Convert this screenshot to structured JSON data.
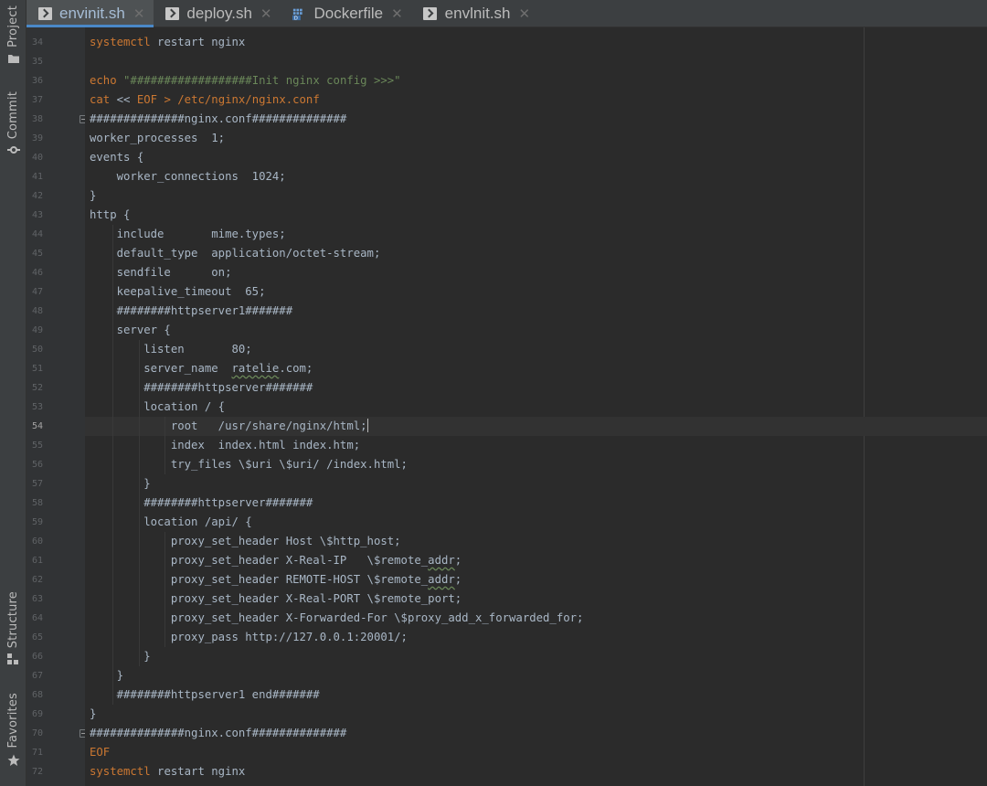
{
  "tool_window_bar": {
    "project_label": "Project",
    "commit_label": "Commit",
    "structure_label": "Structure",
    "favorites_label": "Favorites"
  },
  "tabs": [
    {
      "label": "envinit.sh",
      "icon": "shell-script-icon",
      "active": true
    },
    {
      "label": "deploy.sh",
      "icon": "shell-script-icon",
      "active": false
    },
    {
      "label": "Dockerfile",
      "icon": "docker-icon",
      "active": false
    },
    {
      "label": "envlnit.sh",
      "icon": "shell-script-icon",
      "active": false
    }
  ],
  "editor": {
    "current_line": 54,
    "line_numbers": [
      "34",
      "35",
      "36",
      "37",
      "38",
      "39",
      "40",
      "41",
      "42",
      "43",
      "44",
      "45",
      "46",
      "47",
      "48",
      "49",
      "50",
      "51",
      "52",
      "53",
      "54",
      "55",
      "56",
      "57",
      "58",
      "59",
      "60",
      "61",
      "62",
      "63",
      "64",
      "65",
      "66",
      "67",
      "68",
      "69",
      "70",
      "71",
      "72"
    ],
    "lines": [
      {
        "n": 34,
        "segs": [
          {
            "t": "systemctl",
            "c": "kw"
          },
          {
            "t": " restart nginx",
            "c": "plain"
          }
        ]
      },
      {
        "n": 35,
        "segs": []
      },
      {
        "n": 36,
        "segs": [
          {
            "t": "echo",
            "c": "kw"
          },
          {
            "t": " ",
            "c": "plain"
          },
          {
            "t": "\"##################Init nginx config >>>\"",
            "c": "str"
          }
        ]
      },
      {
        "n": 37,
        "segs": [
          {
            "t": "cat",
            "c": "kw"
          },
          {
            "t": " << ",
            "c": "plain"
          },
          {
            "t": "EOF",
            "c": "kw"
          },
          {
            "t": " > /etc/nginx/nginx.conf",
            "c": "kw"
          }
        ]
      },
      {
        "n": 38,
        "segs": [
          {
            "t": "##############nginx.conf##############",
            "c": "plain"
          }
        ]
      },
      {
        "n": 39,
        "segs": [
          {
            "t": "worker_processes  1;",
            "c": "plain"
          }
        ]
      },
      {
        "n": 40,
        "segs": [
          {
            "t": "events {",
            "c": "plain"
          }
        ]
      },
      {
        "n": 41,
        "segs": [
          {
            "t": "    worker_connections  1024;",
            "c": "plain"
          }
        ]
      },
      {
        "n": 42,
        "segs": [
          {
            "t": "}",
            "c": "plain"
          }
        ]
      },
      {
        "n": 43,
        "segs": [
          {
            "t": "http {",
            "c": "plain"
          }
        ]
      },
      {
        "n": 44,
        "segs": [
          {
            "t": "    include       mime.types;",
            "c": "plain"
          }
        ]
      },
      {
        "n": 45,
        "segs": [
          {
            "t": "    default_type  application/octet-stream;",
            "c": "plain"
          }
        ]
      },
      {
        "n": 46,
        "segs": [
          {
            "t": "    sendfile      on;",
            "c": "plain"
          }
        ]
      },
      {
        "n": 47,
        "segs": [
          {
            "t": "    keepalive_timeout  65;",
            "c": "plain"
          }
        ]
      },
      {
        "n": 48,
        "segs": [
          {
            "t": "    ########httpserver1#######",
            "c": "plain"
          }
        ]
      },
      {
        "n": 49,
        "segs": [
          {
            "t": "    server {",
            "c": "plain"
          }
        ]
      },
      {
        "n": 50,
        "segs": [
          {
            "t": "        listen       80;",
            "c": "plain"
          }
        ]
      },
      {
        "n": 51,
        "segs": [
          {
            "t": "        server_name  ",
            "c": "plain"
          },
          {
            "t": "ratelie",
            "c": "sq"
          },
          {
            "t": ".com;",
            "c": "plain"
          }
        ]
      },
      {
        "n": 52,
        "segs": [
          {
            "t": "        ########httpserver#######",
            "c": "plain"
          }
        ]
      },
      {
        "n": 53,
        "segs": [
          {
            "t": "        location / {",
            "c": "plain"
          }
        ]
      },
      {
        "n": 54,
        "segs": [
          {
            "t": "            root   /usr/share/nginx/html;",
            "c": "plain"
          }
        ]
      },
      {
        "n": 55,
        "segs": [
          {
            "t": "            index  index.html index.htm;",
            "c": "plain"
          }
        ]
      },
      {
        "n": 56,
        "segs": [
          {
            "t": "            try_files \\$uri \\$uri/ /index.html;",
            "c": "plain"
          }
        ]
      },
      {
        "n": 57,
        "segs": [
          {
            "t": "        }",
            "c": "plain"
          }
        ]
      },
      {
        "n": 58,
        "segs": [
          {
            "t": "        ########httpserver#######",
            "c": "plain"
          }
        ]
      },
      {
        "n": 59,
        "segs": [
          {
            "t": "        location /api/ {",
            "c": "plain"
          }
        ]
      },
      {
        "n": 60,
        "segs": [
          {
            "t": "            proxy_set_header Host \\$http_host;",
            "c": "plain"
          }
        ]
      },
      {
        "n": 61,
        "segs": [
          {
            "t": "            proxy_set_header X-Real-IP   \\$remote_",
            "c": "plain"
          },
          {
            "t": "addr",
            "c": "sq"
          },
          {
            "t": ";",
            "c": "plain"
          }
        ]
      },
      {
        "n": 62,
        "segs": [
          {
            "t": "            proxy_set_header REMOTE-HOST \\$remote_",
            "c": "plain"
          },
          {
            "t": "addr",
            "c": "sq"
          },
          {
            "t": ";",
            "c": "plain"
          }
        ]
      },
      {
        "n": 63,
        "segs": [
          {
            "t": "            proxy_set_header X-Real-PORT \\$remote_port;",
            "c": "plain"
          }
        ]
      },
      {
        "n": 64,
        "segs": [
          {
            "t": "            proxy_set_header X-Forwarded-For \\$proxy_add_x_forwarded_for;",
            "c": "plain"
          }
        ]
      },
      {
        "n": 65,
        "segs": [
          {
            "t": "            proxy_pass http://127.0.0.1:20001/;",
            "c": "plain"
          }
        ]
      },
      {
        "n": 66,
        "segs": [
          {
            "t": "        }",
            "c": "plain"
          }
        ]
      },
      {
        "n": 67,
        "segs": [
          {
            "t": "    }",
            "c": "plain"
          }
        ]
      },
      {
        "n": 68,
        "segs": [
          {
            "t": "    ########httpserver1 end#######",
            "c": "plain"
          }
        ]
      },
      {
        "n": 69,
        "segs": [
          {
            "t": "}",
            "c": "plain"
          }
        ]
      },
      {
        "n": 70,
        "segs": [
          {
            "t": "##############nginx.conf##############",
            "c": "plain"
          }
        ]
      },
      {
        "n": 71,
        "segs": [
          {
            "t": "EOF",
            "c": "kw"
          }
        ]
      },
      {
        "n": 72,
        "segs": [
          {
            "t": "systemctl",
            "c": "kw"
          },
          {
            "t": " restart nginx",
            "c": "plain"
          }
        ]
      }
    ]
  },
  "colors": {
    "keyword": "#cc7832",
    "string": "#6a8759",
    "text": "#a9b7c6",
    "background": "#2b2b2b",
    "gutter": "#313335",
    "tab_accent": "#4a88c7"
  }
}
